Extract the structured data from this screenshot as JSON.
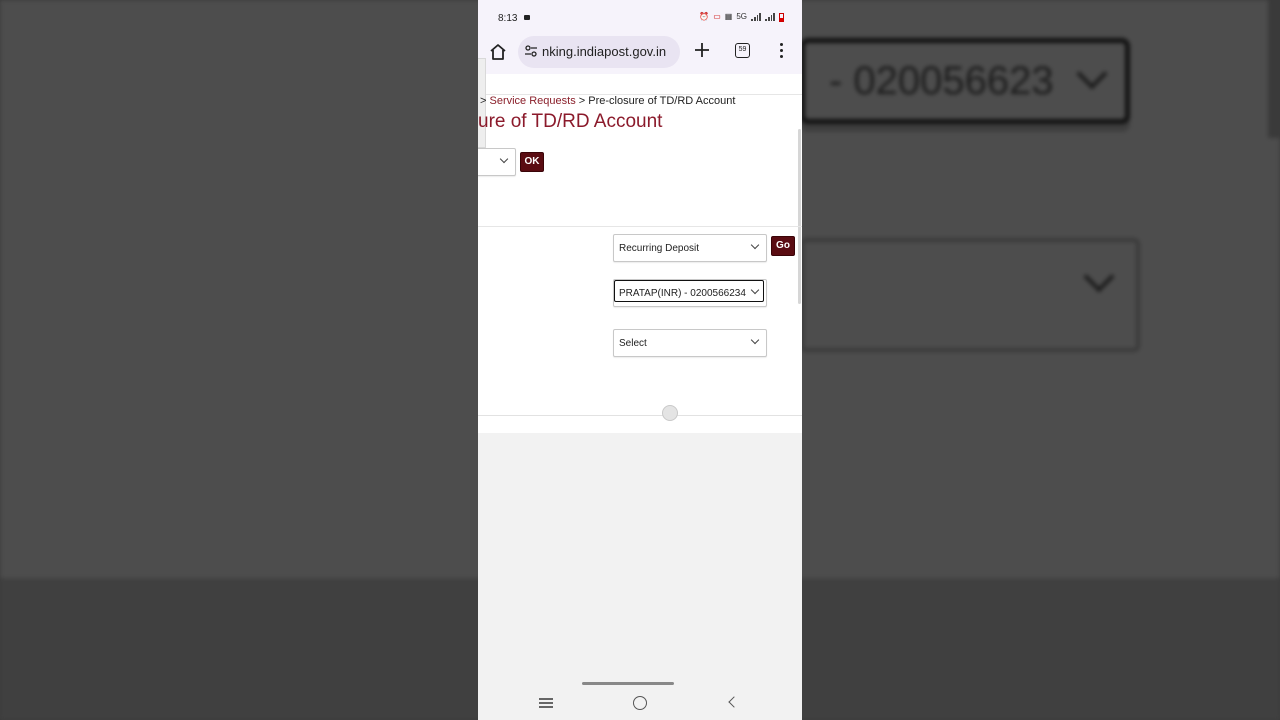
{
  "status_bar": {
    "time": "8:13",
    "network": "5G"
  },
  "browser": {
    "url": "nking.indiapost.gov.in",
    "tab_count": "59"
  },
  "breadcrumb": {
    "separator_1": ">",
    "link": "Service Requests",
    "separator_2": ">",
    "current": "Pre-closure of TD/RD Account"
  },
  "page": {
    "title": "ure of TD/RD Account"
  },
  "form": {
    "ok_label": "OK",
    "go_label": "Go",
    "account_type": "Recurring Deposit",
    "account_select": "PRATAP(INR) - 0200566234",
    "third_select": "Select"
  },
  "background": {
    "zoom_text": "- 020056623"
  },
  "colors": {
    "title": "#8b1a2b",
    "button": "#5a0c12",
    "link": "#8a1f2a"
  }
}
